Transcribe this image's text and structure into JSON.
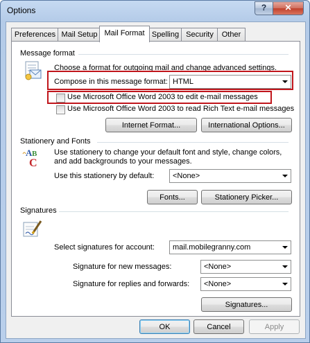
{
  "window": {
    "title": "Options",
    "help_glyph": "?",
    "close_glyph": "✕"
  },
  "tabs": [
    "Preferences",
    "Mail Setup",
    "Mail Format",
    "Spelling",
    "Security",
    "Other"
  ],
  "active_tab": "Mail Format",
  "message_format": {
    "heading": "Message format",
    "description": "Choose a format for outgoing mail and change advanced settings.",
    "compose_label": "Compose in this message format:",
    "compose_value": "HTML",
    "use_word_edit_label": "Use Microsoft Office Word 2003 to edit e-mail messages",
    "use_word_read_label": "Use Microsoft Office Word 2003 to read Rich Text e-mail messages",
    "internet_format_button": "Internet Format...",
    "international_options_button": "International Options..."
  },
  "stationery": {
    "heading": "Stationery and Fonts",
    "description_line1": "Use stationery to change your default font and style, change colors,",
    "description_line2": "and add backgrounds to your messages.",
    "default_label": "Use this stationery by default:",
    "default_value": "<None>",
    "fonts_button": "Fonts...",
    "stationery_picker_button": "Stationery Picker..."
  },
  "signatures": {
    "heading": "Signatures",
    "account_label": "Select signatures for account:",
    "account_value": "mail.mobilegranny.com",
    "new_messages_label": "Signature for new messages:",
    "new_messages_value": "<None>",
    "replies_label": "Signature for replies and forwards:",
    "replies_value": "<None>",
    "signatures_button": "Signatures..."
  },
  "footer": {
    "ok": "OK",
    "cancel": "Cancel",
    "apply": "Apply"
  },
  "colors": {
    "highlight_red": "#c0151b",
    "title_bar": "#b9cfeb"
  },
  "icons": [
    "message-format-icon",
    "stationery-abc-icon",
    "signature-pen-icon",
    "help-icon",
    "close-icon"
  ]
}
